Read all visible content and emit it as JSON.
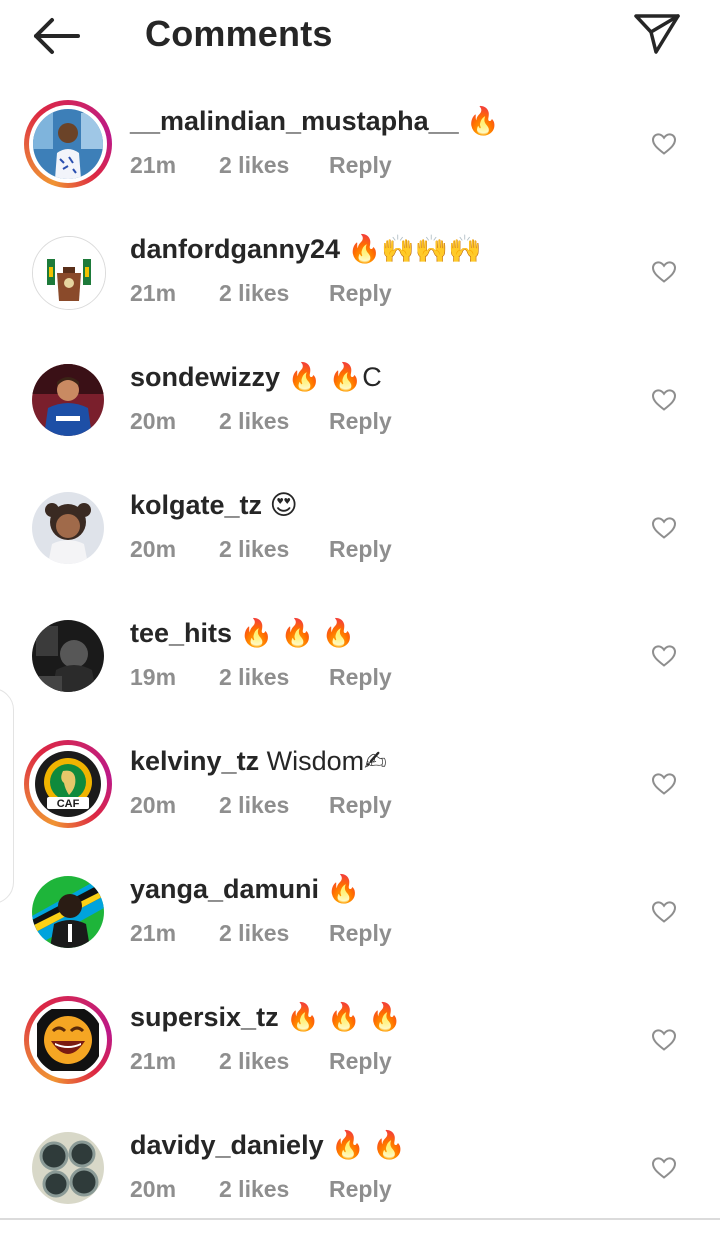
{
  "header": {
    "title": "Comments",
    "back_icon": "arrow-left-icon",
    "share_icon": "paper-plane-icon"
  },
  "actions": {
    "reply_label": "Reply"
  },
  "comments": [
    {
      "username": "__malindian_mustapha__",
      "text": "🔥",
      "time": "21m",
      "likes": "2 likes",
      "story_ring": true
    },
    {
      "username": "danfordganny24",
      "text": "🔥🙌🙌🙌",
      "time": "21m",
      "likes": "2 likes",
      "story_ring": false
    },
    {
      "username": "sondewizzy",
      "text": "🔥 🔥C",
      "time": "20m",
      "likes": "2 likes",
      "story_ring": false
    },
    {
      "username": "kolgate_tz",
      "text": "😍",
      "time": "20m",
      "likes": "2 likes",
      "story_ring": false
    },
    {
      "username": "tee_hits",
      "text": "🔥 🔥 🔥",
      "time": "19m",
      "likes": "2 likes",
      "story_ring": false
    },
    {
      "username": "kelviny_tz",
      "text": "Wisdom✍",
      "time": "20m",
      "likes": "2 likes",
      "story_ring": true
    },
    {
      "username": "yanga_damuni",
      "text": "🔥",
      "time": "21m",
      "likes": "2 likes",
      "story_ring": false
    },
    {
      "username": "supersix_tz",
      "text": "🔥 🔥 🔥",
      "time": "21m",
      "likes": "2 likes",
      "story_ring": true
    },
    {
      "username": "davidy_daniely",
      "text": "🔥 🔥",
      "time": "20m",
      "likes": "2 likes",
      "story_ring": false
    }
  ],
  "colors": {
    "text": "#262626",
    "meta": "#8e8e8e",
    "story_ring": [
      "#f09433",
      "#dc2743",
      "#bc1888"
    ]
  }
}
